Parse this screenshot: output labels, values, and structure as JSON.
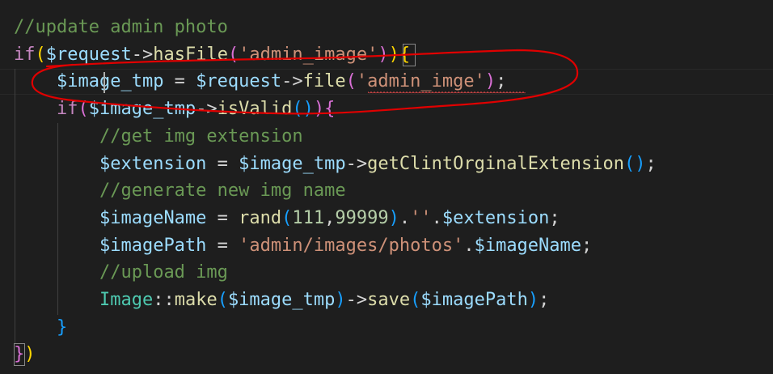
{
  "colors": {
    "background": "#1e1e1e",
    "comment": "#6a9955",
    "keyword": "#c586c0",
    "variable": "#9cdcfe",
    "function": "#dcdcaa",
    "string": "#ce9178",
    "number": "#b5cea8",
    "class": "#4ec9b0",
    "operator": "#d4d4d4",
    "bracket_gold": "#ffd700",
    "bracket_pink": "#da70d6",
    "bracket_blue": "#179fff",
    "annotation_stroke": "#e00000",
    "squiggle": "#f14c4c"
  },
  "editor": {
    "lines": [
      {
        "name": "comment-update-admin-photo",
        "tokens": [
          {
            "t": "//update admin photo",
            "c": "comment"
          }
        ]
      },
      {
        "name": "if-hasfile",
        "tokens": [
          {
            "t": "if",
            "c": "keyword"
          },
          {
            "t": "(",
            "c": "bracket_gold"
          },
          {
            "t": "$request",
            "c": "variable"
          },
          {
            "t": "->",
            "c": "operator"
          },
          {
            "t": "hasFile",
            "c": "function"
          },
          {
            "t": "(",
            "c": "bracket_pink"
          },
          {
            "t": "'admin_image'",
            "c": "string"
          },
          {
            "t": ")",
            "c": "bracket_pink"
          },
          {
            "t": "){",
            "c": "bracket_gold"
          }
        ]
      },
      {
        "name": "assign-image-tmp",
        "tokens": [
          {
            "t": "    ",
            "c": "operator"
          },
          {
            "t": "$image_tmp",
            "c": "variable"
          },
          {
            "t": " = ",
            "c": "operator"
          },
          {
            "t": "$request",
            "c": "variable"
          },
          {
            "t": "->",
            "c": "operator"
          },
          {
            "t": "file",
            "c": "function"
          },
          {
            "t": "(",
            "c": "bracket_pink"
          },
          {
            "t": "'admin_imge'",
            "c": "string"
          },
          {
            "t": ")",
            "c": "bracket_pink"
          },
          {
            "t": ";",
            "c": "operator"
          }
        ]
      },
      {
        "name": "if-isvalid",
        "tokens": [
          {
            "t": "    ",
            "c": "operator"
          },
          {
            "t": "if",
            "c": "keyword"
          },
          {
            "t": "(",
            "c": "bracket_pink"
          },
          {
            "t": "$image_tmp",
            "c": "variable"
          },
          {
            "t": "->",
            "c": "operator"
          },
          {
            "t": "isValid",
            "c": "function"
          },
          {
            "t": "()",
            "c": "bracket_blue"
          },
          {
            "t": "){",
            "c": "bracket_pink"
          }
        ]
      },
      {
        "name": "comment-get-img-extension",
        "tokens": [
          {
            "t": "        ",
            "c": "operator"
          },
          {
            "t": "//get img extension",
            "c": "comment"
          }
        ]
      },
      {
        "name": "assign-extension",
        "tokens": [
          {
            "t": "        ",
            "c": "operator"
          },
          {
            "t": "$extension",
            "c": "variable"
          },
          {
            "t": " = ",
            "c": "operator"
          },
          {
            "t": "$image_tmp",
            "c": "variable"
          },
          {
            "t": "->",
            "c": "operator"
          },
          {
            "t": "getClintOrginalExtension",
            "c": "function"
          },
          {
            "t": "()",
            "c": "bracket_blue"
          },
          {
            "t": ";",
            "c": "operator"
          }
        ]
      },
      {
        "name": "comment-generate-new-img-name",
        "tokens": [
          {
            "t": "        ",
            "c": "operator"
          },
          {
            "t": "//generate new img name",
            "c": "comment"
          }
        ]
      },
      {
        "name": "assign-image-name",
        "tokens": [
          {
            "t": "        ",
            "c": "operator"
          },
          {
            "t": "$imageName",
            "c": "variable"
          },
          {
            "t": " = ",
            "c": "operator"
          },
          {
            "t": "rand",
            "c": "function"
          },
          {
            "t": "(",
            "c": "bracket_blue"
          },
          {
            "t": "111",
            "c": "number"
          },
          {
            "t": ",",
            "c": "operator"
          },
          {
            "t": "99999",
            "c": "number"
          },
          {
            "t": ")",
            "c": "bracket_blue"
          },
          {
            "t": ".",
            "c": "operator"
          },
          {
            "t": "''",
            "c": "string"
          },
          {
            "t": ".",
            "c": "operator"
          },
          {
            "t": "$extension",
            "c": "variable"
          },
          {
            "t": ";",
            "c": "operator"
          }
        ]
      },
      {
        "name": "assign-image-path",
        "tokens": [
          {
            "t": "        ",
            "c": "operator"
          },
          {
            "t": "$imagePath",
            "c": "variable"
          },
          {
            "t": " = ",
            "c": "operator"
          },
          {
            "t": "'admin/images/photos'",
            "c": "string"
          },
          {
            "t": ".",
            "c": "operator"
          },
          {
            "t": "$imageName",
            "c": "variable"
          },
          {
            "t": ";",
            "c": "operator"
          }
        ]
      },
      {
        "name": "comment-upload-img",
        "tokens": [
          {
            "t": "        ",
            "c": "operator"
          },
          {
            "t": "//upload img",
            "c": "comment"
          }
        ]
      },
      {
        "name": "image-make-save",
        "tokens": [
          {
            "t": "        ",
            "c": "operator"
          },
          {
            "t": "Image",
            "c": "class"
          },
          {
            "t": "::",
            "c": "operator"
          },
          {
            "t": "make",
            "c": "function"
          },
          {
            "t": "(",
            "c": "bracket_blue"
          },
          {
            "t": "$image_tmp",
            "c": "variable"
          },
          {
            "t": ")",
            "c": "bracket_blue"
          },
          {
            "t": "->",
            "c": "operator"
          },
          {
            "t": "save",
            "c": "function"
          },
          {
            "t": "(",
            "c": "bracket_blue"
          },
          {
            "t": "$imagePath",
            "c": "variable"
          },
          {
            "t": ")",
            "c": "bracket_blue"
          },
          {
            "t": ";",
            "c": "operator"
          }
        ]
      },
      {
        "name": "close-if-isvalid",
        "tokens": [
          {
            "t": "    ",
            "c": "operator"
          },
          {
            "t": "}",
            "c": "bracket_blue"
          }
        ]
      },
      {
        "name": "close-if-hasfile",
        "tokens": [
          {
            "t": "}",
            "c": "bracket_pink"
          },
          {
            "t": ")",
            "c": "bracket_gold"
          }
        ]
      }
    ]
  }
}
